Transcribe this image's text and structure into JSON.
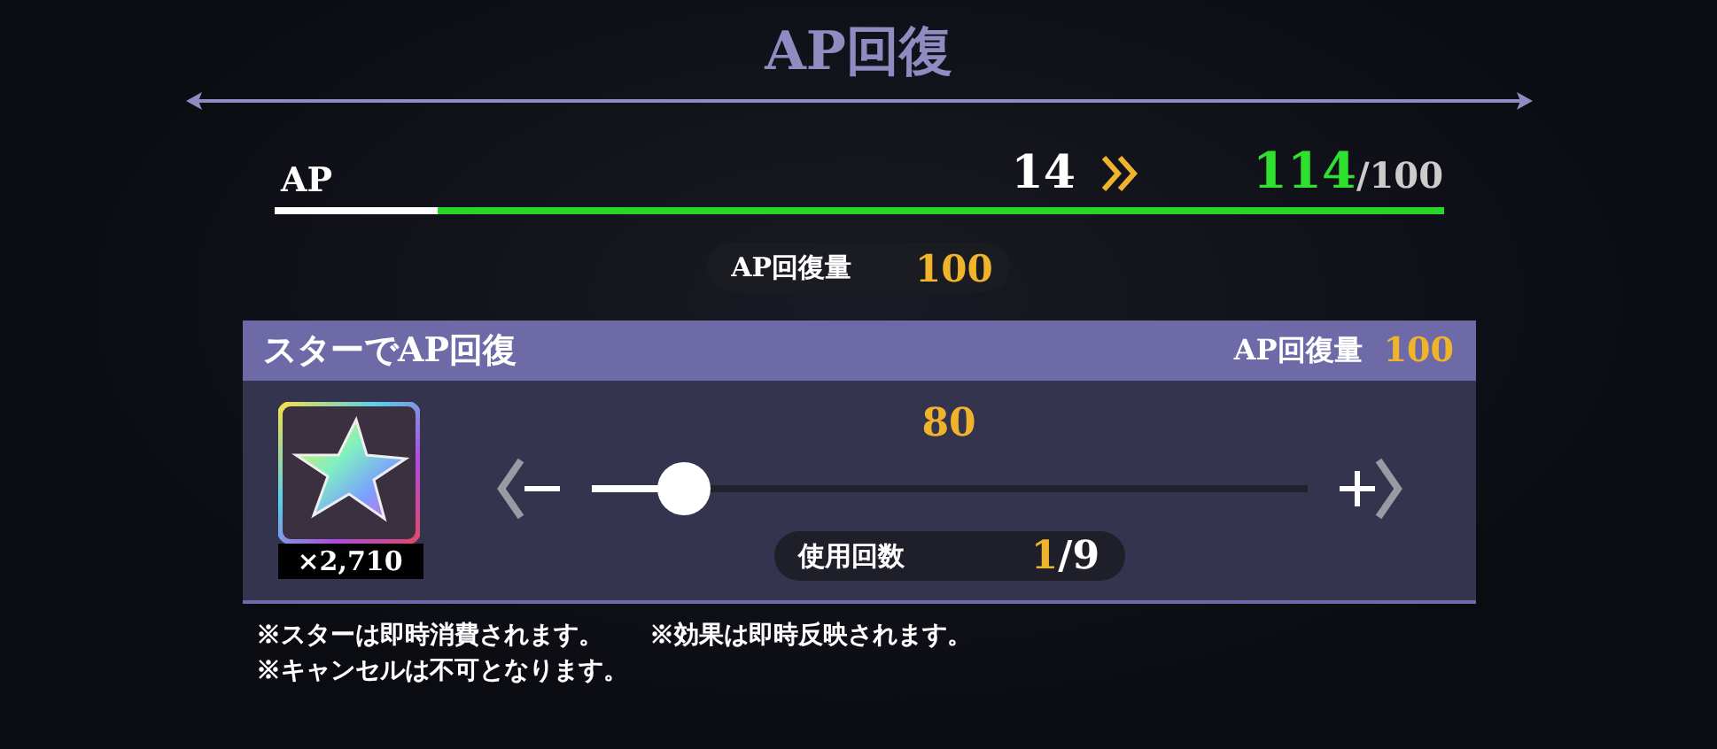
{
  "title": "AP回復",
  "ap": {
    "label": "AP",
    "current": "14",
    "after": "114",
    "max": "/100",
    "level": 0.14
  },
  "recovery_pill": {
    "label": "AP回復量",
    "value": "100"
  },
  "panel": {
    "title": "スターでAP回復",
    "recovery_label": "AP回復量",
    "recovery_value": "100",
    "item": {
      "count": "×2,710"
    },
    "slider": {
      "value": "80",
      "level": 0.13
    },
    "usage": {
      "label": "使用回数",
      "used": "1",
      "total": "/9"
    }
  },
  "notes": [
    {
      "texts": [
        "※スターは即時消費されます。",
        "※効果は即時反映されます。"
      ]
    },
    {
      "texts": [
        "※キャンセルは不可となります。"
      ]
    }
  ]
}
